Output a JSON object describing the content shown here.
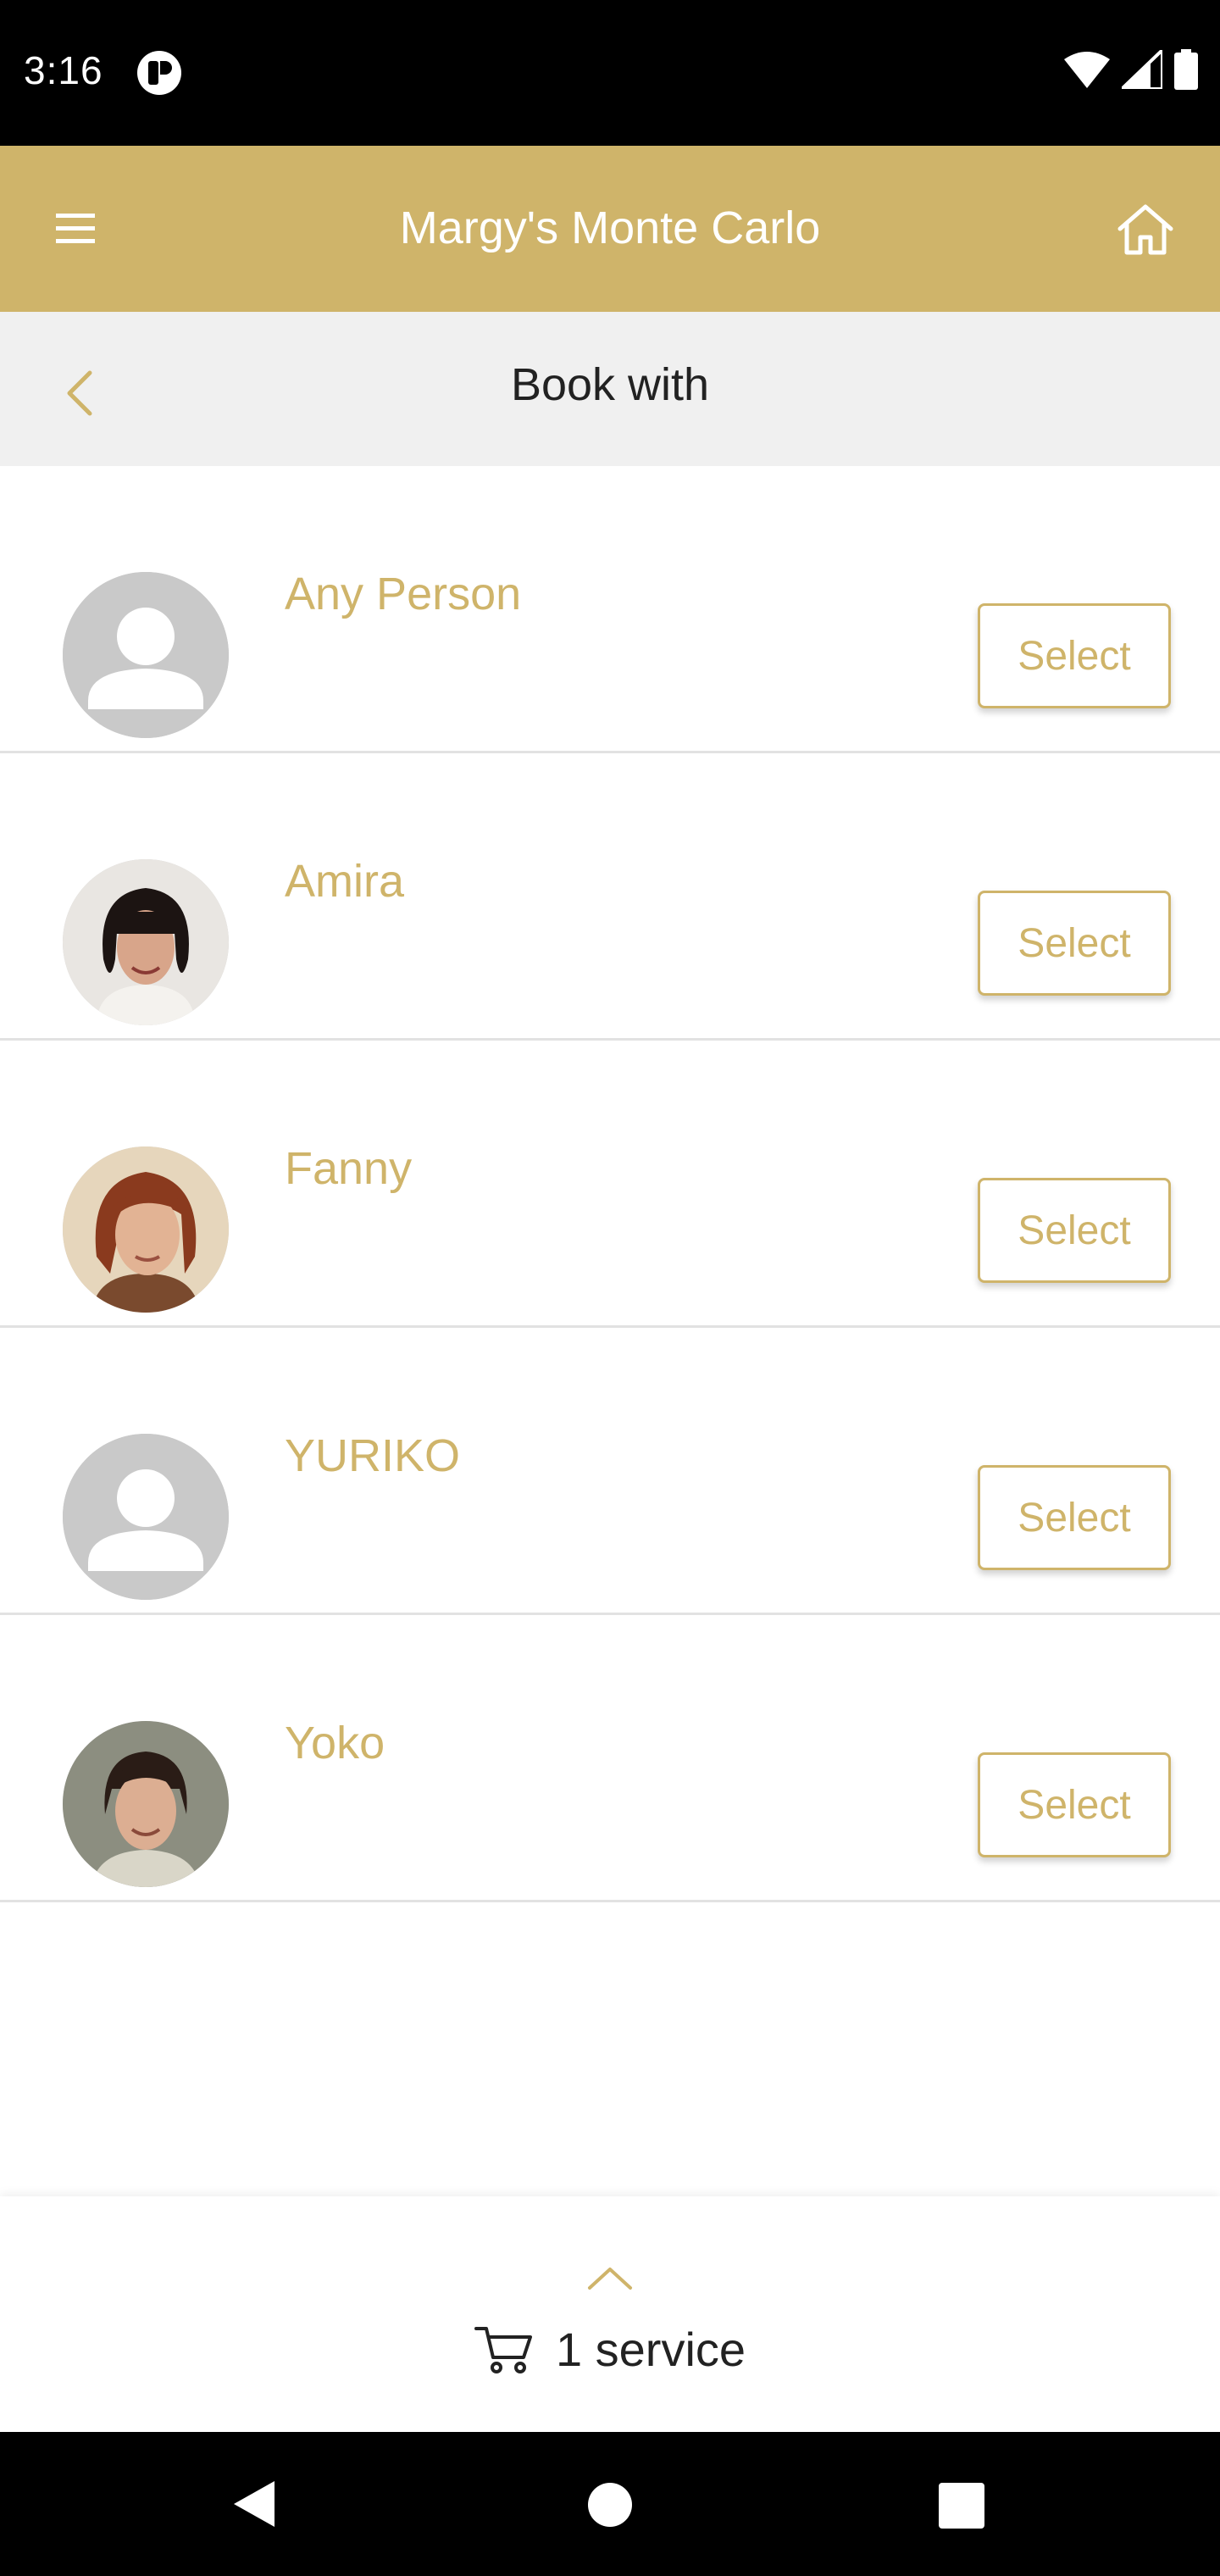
{
  "status_bar": {
    "time": "3:16"
  },
  "header": {
    "title": "Margy's Monte Carlo"
  },
  "subheader": {
    "title": "Book with"
  },
  "staff": [
    {
      "name": "Any Person",
      "avatar": "placeholder",
      "select_label": "Select"
    },
    {
      "name": "Amira",
      "avatar": "photo",
      "select_label": "Select"
    },
    {
      "name": "Fanny",
      "avatar": "photo",
      "select_label": "Select"
    },
    {
      "name": "YURIKO",
      "avatar": "placeholder",
      "select_label": "Select"
    },
    {
      "name": "Yoko",
      "avatar": "photo",
      "select_label": "Select"
    }
  ],
  "cart": {
    "label": "1 service"
  },
  "colors": {
    "accent": "#cfb46a",
    "subheader_bg": "#f0f0f0",
    "placeholder_avatar": "#c9c9c9"
  },
  "icons": [
    "menu-icon",
    "home-icon",
    "back-icon",
    "chevron-up-icon",
    "cart-icon"
  ]
}
